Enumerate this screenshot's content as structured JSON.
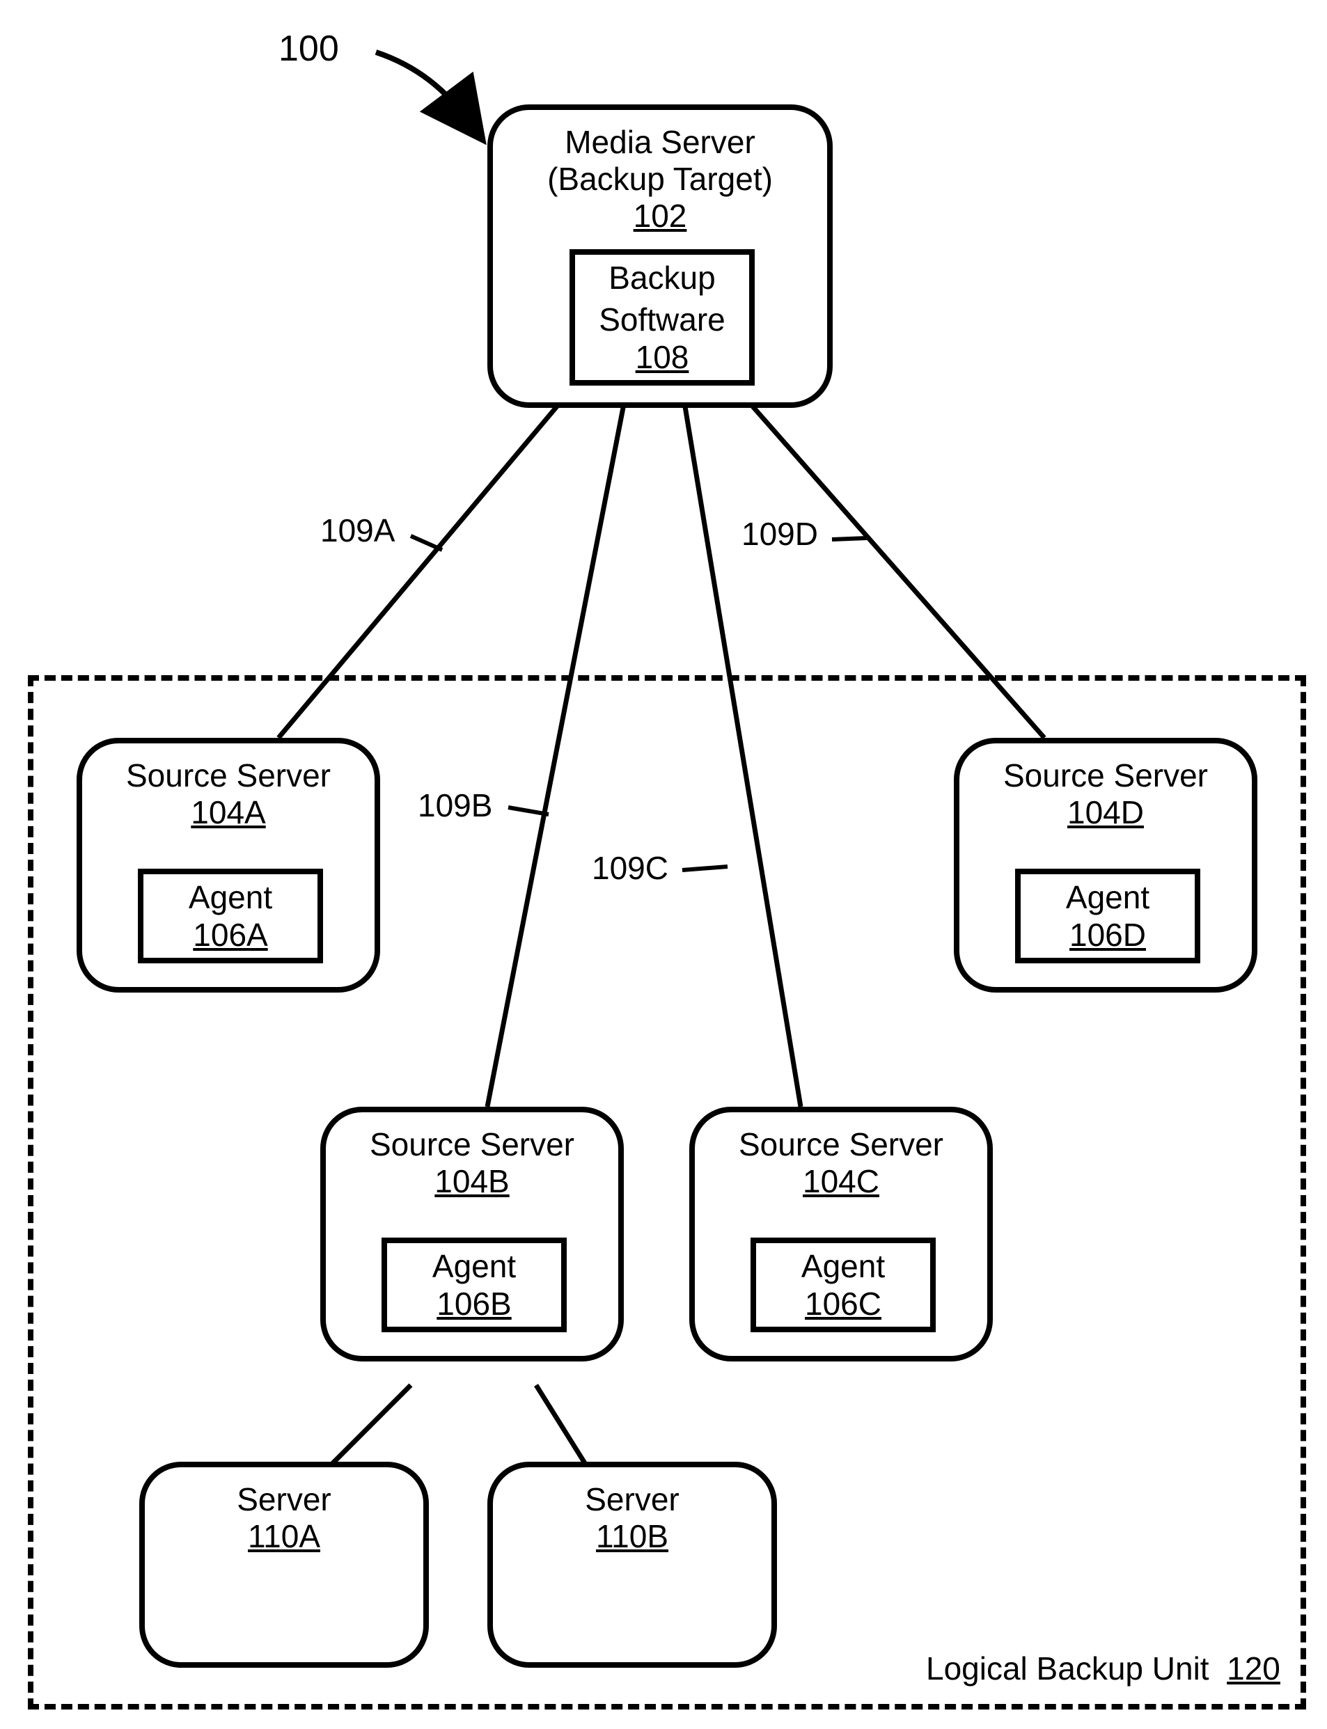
{
  "figure_ref": "100",
  "media_server": {
    "title1": "Media Server",
    "title2": "(Backup Target)",
    "ref": "102",
    "inner": {
      "title": "Backup",
      "title2": "Software",
      "ref": "108"
    }
  },
  "sources": {
    "A": {
      "title": "Source Server",
      "ref": "104A",
      "agent": {
        "title": "Agent",
        "ref": "106A"
      }
    },
    "B": {
      "title": "Source Server",
      "ref": "104B",
      "agent": {
        "title": "Agent",
        "ref": "106B"
      }
    },
    "C": {
      "title": "Source Server",
      "ref": "104C",
      "agent": {
        "title": "Agent",
        "ref": "106C"
      }
    },
    "D": {
      "title": "Source Server",
      "ref": "104D",
      "agent": {
        "title": "Agent",
        "ref": "106D"
      }
    }
  },
  "servers": {
    "A": {
      "title": "Server",
      "ref": "110A"
    },
    "B": {
      "title": "Server",
      "ref": "110B"
    }
  },
  "link_labels": {
    "A": "109A",
    "B": "109B",
    "C": "109C",
    "D": "109D"
  },
  "lbu": {
    "label": "Logical Backup Unit",
    "ref": "120"
  }
}
